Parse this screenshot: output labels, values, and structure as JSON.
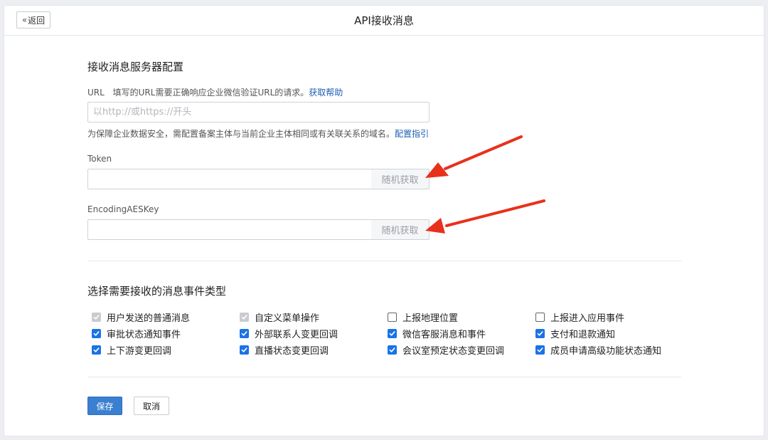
{
  "header": {
    "back_label": "返回",
    "title": "API接收消息"
  },
  "server_config": {
    "section_title": "接收消息服务器配置",
    "url_label": "URL",
    "url_hint": "填写的URL需要正确响应企业微信验证URL的请求。",
    "url_help_link": "获取帮助",
    "url_placeholder": "以http://或https://开头",
    "url_value": "",
    "domain_note": "为保障企业数据安全，需配置备案主体与当前企业主体相同或有关联关系的域名。",
    "domain_guide_link": "配置指引",
    "token_label": "Token",
    "token_value": "",
    "token_random_label": "随机获取",
    "aeskey_label": "EncodingAESKey",
    "aeskey_value": "",
    "aeskey_random_label": "随机获取"
  },
  "events": {
    "section_title": "选择需要接收的消息事件类型",
    "items": [
      {
        "label": "用户发送的普通消息",
        "state": "disabled"
      },
      {
        "label": "自定义菜单操作",
        "state": "disabled"
      },
      {
        "label": "上报地理位置",
        "state": "unchecked"
      },
      {
        "label": "上报进入应用事件",
        "state": "unchecked"
      },
      {
        "label": "审批状态通知事件",
        "state": "checked"
      },
      {
        "label": "外部联系人变更回调",
        "state": "checked"
      },
      {
        "label": "微信客服消息和事件",
        "state": "checked"
      },
      {
        "label": "支付和退款通知",
        "state": "checked"
      },
      {
        "label": "上下游变更回调",
        "state": "checked"
      },
      {
        "label": "直播状态变更回调",
        "state": "checked"
      },
      {
        "label": "会议室预定状态变更回调",
        "state": "checked"
      },
      {
        "label": "成员申请高级功能状态通知",
        "state": "checked"
      }
    ]
  },
  "actions": {
    "save_label": "保存",
    "cancel_label": "取消"
  },
  "colors": {
    "accent": "#3a7fd0",
    "checkbox_checked": "#1a73e8",
    "link": "#1d5fb2",
    "annotation_arrow": "#e8311c"
  }
}
